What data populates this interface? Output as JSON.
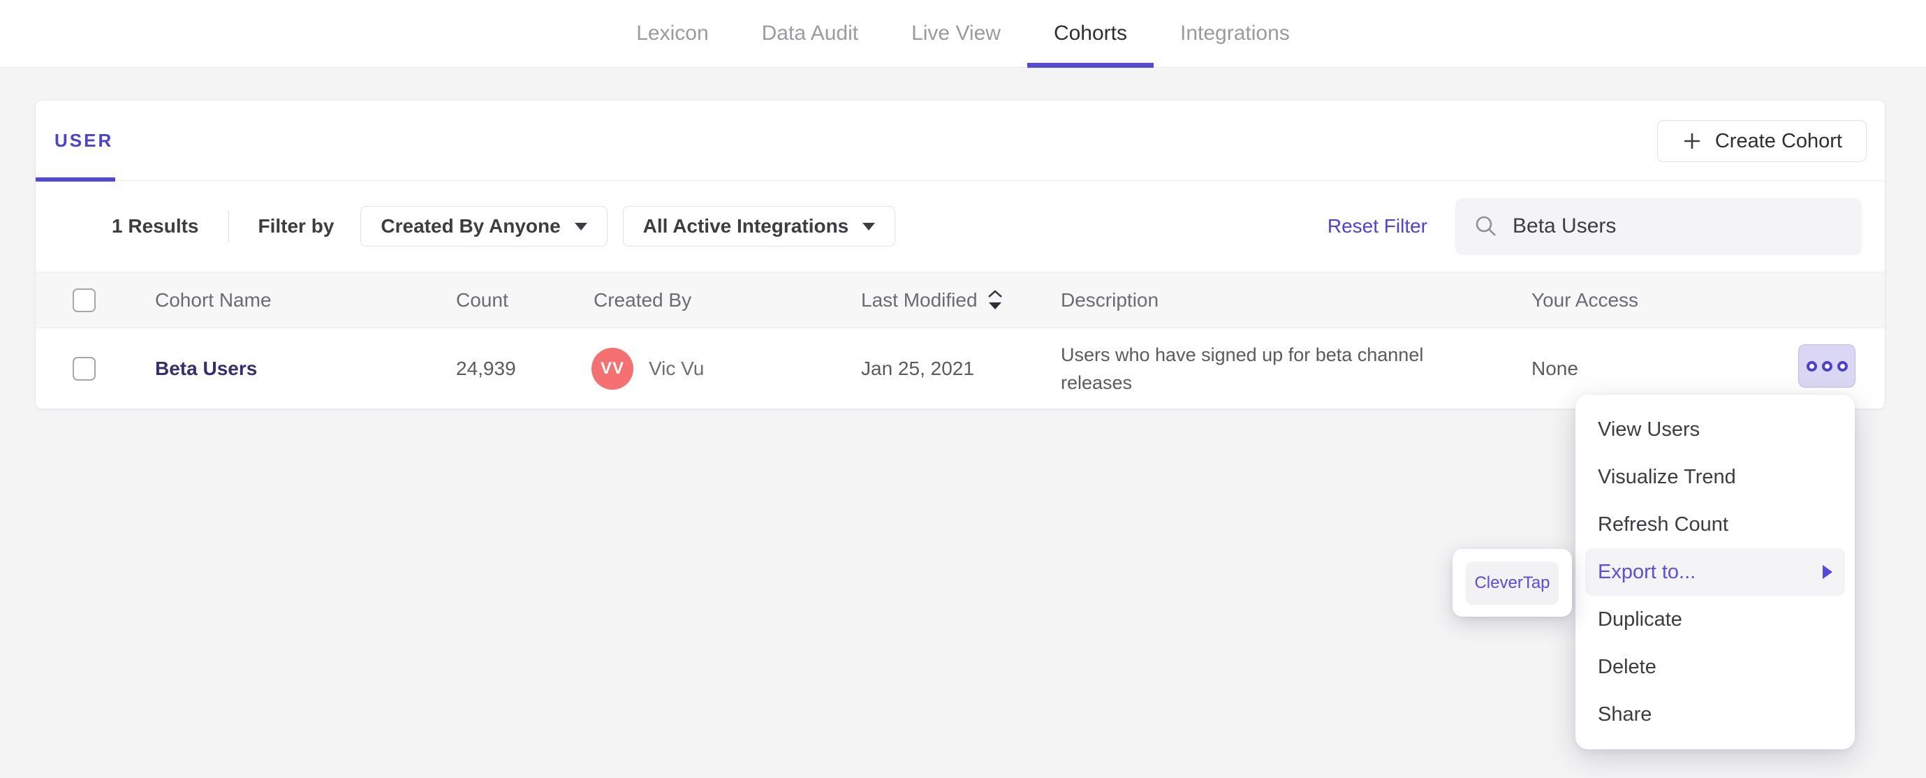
{
  "nav": {
    "tabs": [
      {
        "label": "Lexicon",
        "active": false
      },
      {
        "label": "Data Audit",
        "active": false
      },
      {
        "label": "Live View",
        "active": false
      },
      {
        "label": "Cohorts",
        "active": true
      },
      {
        "label": "Integrations",
        "active": false
      }
    ]
  },
  "card": {
    "tab_label": "USER",
    "create_button_label": "Create Cohort",
    "filters": {
      "results": "1 Results",
      "filter_by_label": "Filter by",
      "created_by_dropdown": "Created By Anyone",
      "integrations_dropdown": "All Active Integrations",
      "reset_link": "Reset Filter",
      "search_value": "Beta Users"
    },
    "table": {
      "headers": [
        "Cohort Name",
        "Count",
        "Created By",
        "Last Modified",
        "Description",
        "Your Access"
      ],
      "rows": [
        {
          "name": "Beta Users",
          "count": "24,939",
          "avatar_initials": "VV",
          "created_by": "Vic Vu",
          "last_modified": "Jan 25, 2021",
          "description": "Users who have signed up for beta channel releases",
          "access": "None"
        }
      ]
    }
  },
  "context_menu": {
    "items": [
      "View Users",
      "Visualize Trend",
      "Refresh Count",
      "Export to...",
      "Duplicate",
      "Delete",
      "Share"
    ],
    "highlighted_item": "Export to...",
    "submenu_items": [
      "CleverTap"
    ]
  },
  "colors": {
    "accent": "#5349d8",
    "accent-dark": "#4a43cf",
    "link": "#4e41e2",
    "menu-link": "#5a50dd",
    "avatar": "#f57070",
    "page-bg": "#f4f4f5",
    "dots-bg": "#d9d7f3",
    "dots-ring": "#4a40d6"
  }
}
